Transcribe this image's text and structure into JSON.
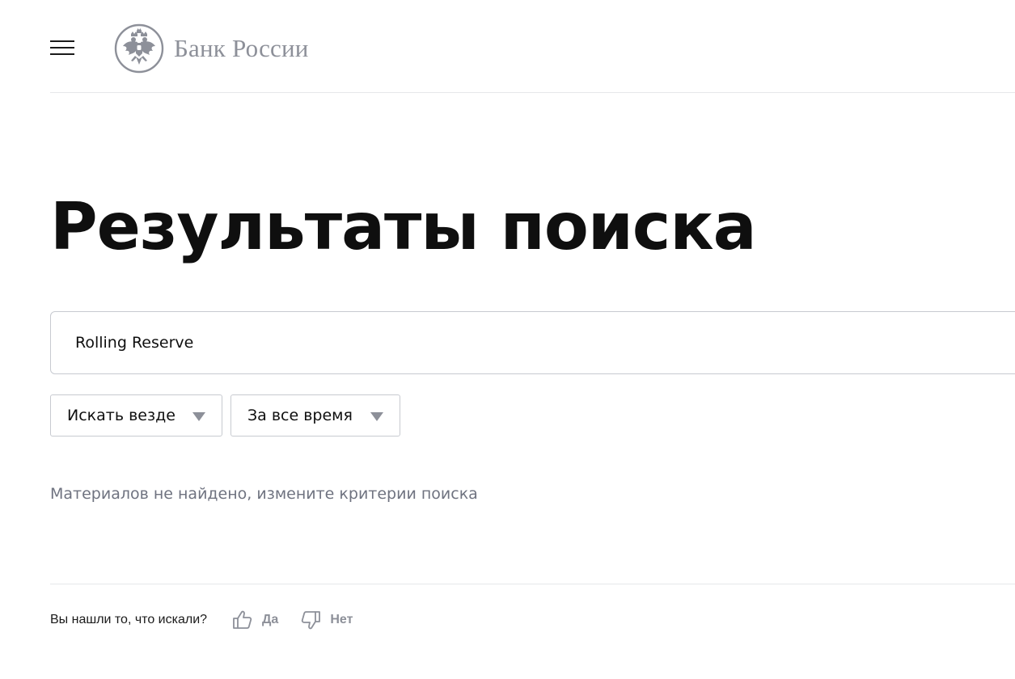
{
  "header": {
    "logo_text": "Банк России"
  },
  "page_title": "Результаты поиска",
  "search": {
    "value": "Rolling Reserve"
  },
  "filters": {
    "scope_selected": "Искать везде",
    "period_selected": "За все время"
  },
  "results": {
    "empty_message": "Материалов не найдено, измените критерии поиска"
  },
  "feedback": {
    "question": "Вы нашли то, что искали?",
    "yes_label": "Да",
    "no_label": "Нет"
  },
  "colors": {
    "text": "#0f0f0f",
    "muted": "#8d9099",
    "border": "#c7cad0",
    "divider": "#e6e7ea"
  }
}
